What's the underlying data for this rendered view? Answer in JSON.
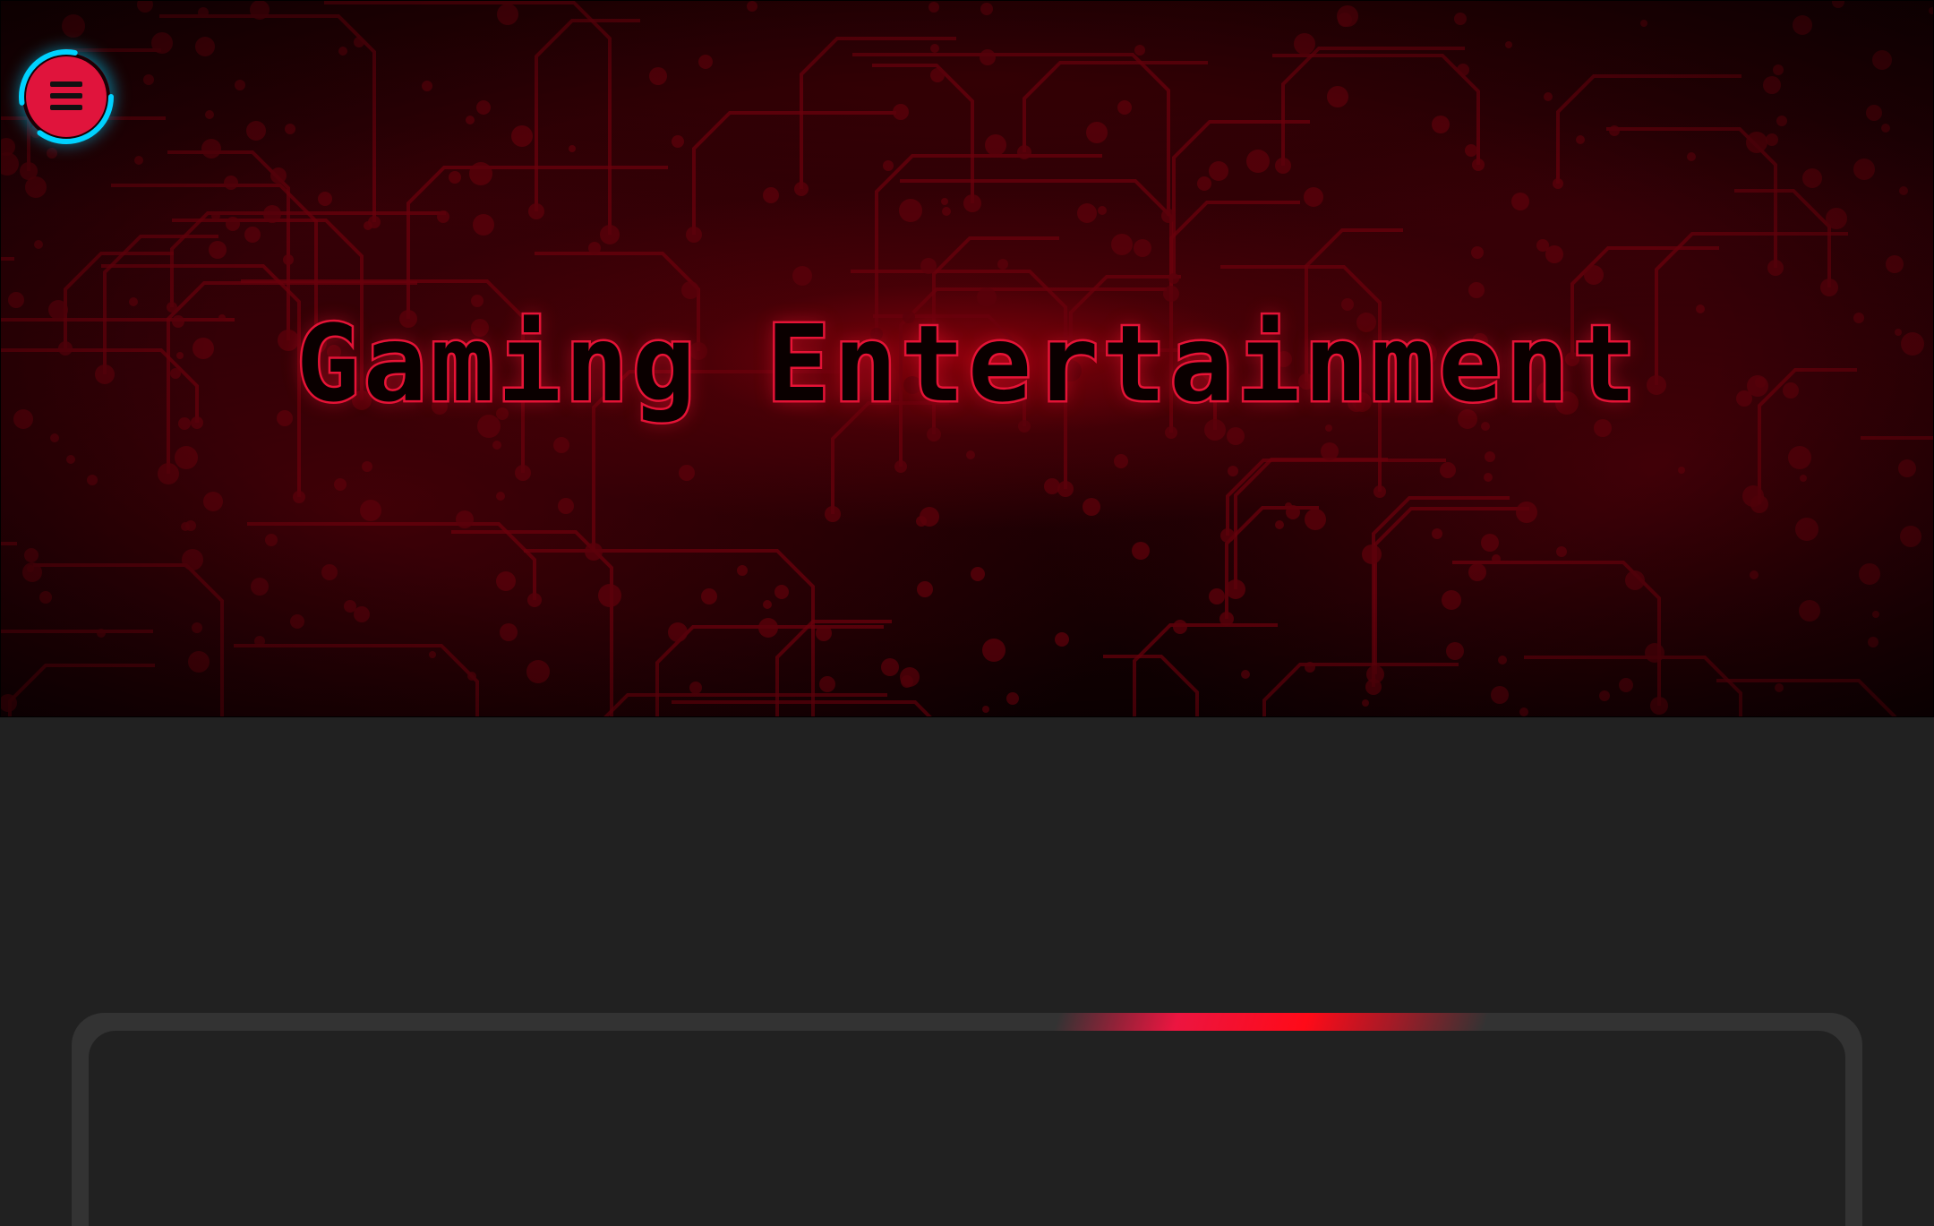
{
  "hero": {
    "title": "Gaming Entertainment"
  },
  "menu": {
    "icon": "hamburger-icon"
  },
  "colors": {
    "accent": "#e0143c",
    "glow": "#00d2ff",
    "background": "#212121",
    "panel_border": "#333333"
  }
}
